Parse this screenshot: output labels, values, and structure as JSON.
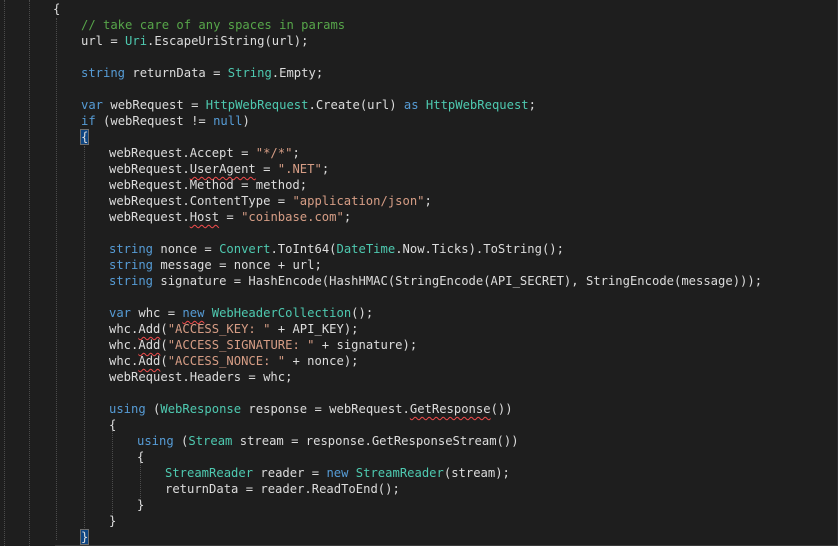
{
  "editor": {
    "language": "C#",
    "colors": {
      "background": "#1e1e1e",
      "keyword": "#569cd6",
      "type": "#4ec9b0",
      "string": "#d69d85",
      "comment": "#57a64a",
      "plain": "#dcdcdc",
      "error_squiggle": "#f14c4c",
      "brace_highlight": "#0e4582"
    },
    "lines": [
      {
        "tokens": [
          {
            "t": "{",
            "c": "plain"
          }
        ]
      },
      {
        "tokens": [
          {
            "t": "// take care of any spaces in params",
            "c": "com"
          }
        ]
      },
      {
        "tokens": [
          {
            "t": "url = ",
            "c": "plain"
          },
          {
            "t": "Uri",
            "c": "type"
          },
          {
            "t": ".EscapeUriString(url);",
            "c": "plain"
          }
        ]
      },
      {
        "tokens": []
      },
      {
        "tokens": [
          {
            "t": "string",
            "c": "kw"
          },
          {
            "t": " returnData = ",
            "c": "plain"
          },
          {
            "t": "String",
            "c": "type"
          },
          {
            "t": ".Empty;",
            "c": "plain"
          }
        ]
      },
      {
        "tokens": []
      },
      {
        "tokens": [
          {
            "t": "var",
            "c": "kw"
          },
          {
            "t": " webRequest = ",
            "c": "plain"
          },
          {
            "t": "HttpWebRequest",
            "c": "type"
          },
          {
            "t": ".Create(url) ",
            "c": "plain"
          },
          {
            "t": "as",
            "c": "kw"
          },
          {
            "t": " ",
            "c": "plain"
          },
          {
            "t": "HttpWebRequest",
            "c": "type"
          },
          {
            "t": ";",
            "c": "plain"
          }
        ]
      },
      {
        "tokens": [
          {
            "t": "if",
            "c": "kw"
          },
          {
            "t": " (webRequest != ",
            "c": "plain"
          },
          {
            "t": "null",
            "c": "kw"
          },
          {
            "t": ")",
            "c": "plain"
          }
        ]
      },
      {
        "tokens": [
          {
            "t": "{",
            "c": "plain",
            "hl": true
          }
        ]
      },
      {
        "tokens": [
          {
            "t": "webRequest.Accept = ",
            "c": "plain"
          },
          {
            "t": "\"*/*\"",
            "c": "str"
          },
          {
            "t": ";",
            "c": "plain"
          }
        ]
      },
      {
        "tokens": [
          {
            "t": "webRequest.",
            "c": "plain"
          },
          {
            "t": "UserAgent",
            "c": "plain",
            "sq": true
          },
          {
            "t": " = ",
            "c": "plain"
          },
          {
            "t": "\".NET\"",
            "c": "str"
          },
          {
            "t": ";",
            "c": "plain"
          }
        ]
      },
      {
        "tokens": [
          {
            "t": "webRequest.Method = method;",
            "c": "plain"
          }
        ]
      },
      {
        "tokens": [
          {
            "t": "webRequest.ContentType = ",
            "c": "plain"
          },
          {
            "t": "\"application/json\"",
            "c": "str"
          },
          {
            "t": ";",
            "c": "plain"
          }
        ]
      },
      {
        "tokens": [
          {
            "t": "webRequest.",
            "c": "plain"
          },
          {
            "t": "Host",
            "c": "plain",
            "sq": true
          },
          {
            "t": " = ",
            "c": "plain"
          },
          {
            "t": "\"coinbase.com\"",
            "c": "str"
          },
          {
            "t": ";",
            "c": "plain"
          }
        ]
      },
      {
        "tokens": []
      },
      {
        "tokens": [
          {
            "t": "string",
            "c": "kw"
          },
          {
            "t": " nonce = ",
            "c": "plain"
          },
          {
            "t": "Convert",
            "c": "type"
          },
          {
            "t": ".ToInt64(",
            "c": "plain"
          },
          {
            "t": "DateTime",
            "c": "type"
          },
          {
            "t": ".Now.Ticks).ToString();",
            "c": "plain"
          }
        ]
      },
      {
        "tokens": [
          {
            "t": "string",
            "c": "kw"
          },
          {
            "t": " message = nonce + url;",
            "c": "plain"
          }
        ]
      },
      {
        "tokens": [
          {
            "t": "string",
            "c": "kw"
          },
          {
            "t": " signature = HashEncode(HashHMAC(StringEncode(API_SECRET), StringEncode(message)));",
            "c": "plain"
          }
        ]
      },
      {
        "tokens": []
      },
      {
        "tokens": [
          {
            "t": "var",
            "c": "kw"
          },
          {
            "t": " whc = ",
            "c": "plain"
          },
          {
            "t": "new",
            "c": "kw",
            "sq": true
          },
          {
            "t": " ",
            "c": "plain"
          },
          {
            "t": "WebHeaderCollection",
            "c": "type"
          },
          {
            "t": "();",
            "c": "plain"
          }
        ]
      },
      {
        "tokens": [
          {
            "t": "whc.",
            "c": "plain"
          },
          {
            "t": "Add",
            "c": "plain",
            "sq": true
          },
          {
            "t": "(",
            "c": "plain"
          },
          {
            "t": "\"ACCESS_KEY: \"",
            "c": "str"
          },
          {
            "t": " + API_KEY);",
            "c": "plain"
          }
        ]
      },
      {
        "tokens": [
          {
            "t": "whc.",
            "c": "plain"
          },
          {
            "t": "Add",
            "c": "plain",
            "sq": true
          },
          {
            "t": "(",
            "c": "plain"
          },
          {
            "t": "\"ACCESS_SIGNATURE: \"",
            "c": "str"
          },
          {
            "t": " + signature);",
            "c": "plain"
          }
        ]
      },
      {
        "tokens": [
          {
            "t": "whc.",
            "c": "plain"
          },
          {
            "t": "Add",
            "c": "plain",
            "sq": true
          },
          {
            "t": "(",
            "c": "plain"
          },
          {
            "t": "\"ACCESS_NONCE: \"",
            "c": "str"
          },
          {
            "t": " + nonce);",
            "c": "plain"
          }
        ]
      },
      {
        "tokens": [
          {
            "t": "webRequest.Headers = whc;",
            "c": "plain"
          }
        ]
      },
      {
        "tokens": []
      },
      {
        "tokens": [
          {
            "t": "using",
            "c": "kw"
          },
          {
            "t": " (",
            "c": "plain"
          },
          {
            "t": "WebResponse",
            "c": "type"
          },
          {
            "t": " response = webRequest.",
            "c": "plain"
          },
          {
            "t": "GetResponse",
            "c": "plain",
            "sq": true
          },
          {
            "t": "())",
            "c": "plain"
          }
        ]
      },
      {
        "tokens": [
          {
            "t": "{",
            "c": "plain"
          }
        ]
      },
      {
        "tokens": [
          {
            "t": "using",
            "c": "kw"
          },
          {
            "t": " (",
            "c": "plain"
          },
          {
            "t": "Stream",
            "c": "type"
          },
          {
            "t": " stream = response.GetResponseStream())",
            "c": "plain"
          }
        ]
      },
      {
        "tokens": [
          {
            "t": "{",
            "c": "plain"
          }
        ]
      },
      {
        "tokens": [
          {
            "t": "StreamReader",
            "c": "type"
          },
          {
            "t": " reader = ",
            "c": "plain"
          },
          {
            "t": "new",
            "c": "kw"
          },
          {
            "t": " ",
            "c": "plain"
          },
          {
            "t": "StreamReader",
            "c": "type"
          },
          {
            "t": "(stream);",
            "c": "plain"
          }
        ]
      },
      {
        "tokens": [
          {
            "t": "returnData = reader.ReadToEnd();",
            "c": "plain"
          }
        ]
      },
      {
        "tokens": [
          {
            "t": "}",
            "c": "plain"
          }
        ]
      },
      {
        "tokens": [
          {
            "t": "}",
            "c": "plain"
          }
        ]
      },
      {
        "tokens": [
          {
            "t": "}",
            "c": "plain",
            "hl": true
          }
        ]
      }
    ]
  }
}
